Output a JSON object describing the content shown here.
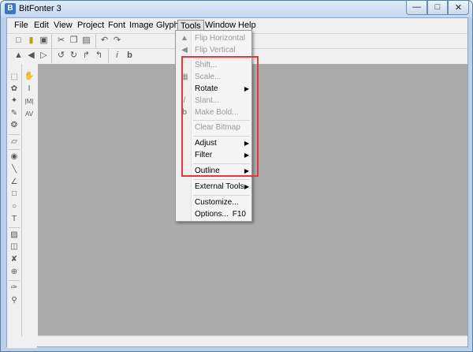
{
  "window": {
    "title": "BitFonter 3",
    "app_icon": "B"
  },
  "menubar": [
    "File",
    "Edit",
    "View",
    "Project",
    "Font",
    "Image",
    "Glyph",
    "Tools",
    "Window",
    "Help"
  ],
  "open_menu": "Tools",
  "tools_menu": {
    "items": [
      {
        "label": "Flip Horizontal",
        "enabled": false,
        "icon": "flip-horizontal-icon"
      },
      {
        "label": "Flip Vertical",
        "enabled": false,
        "icon": "flip-vertical-icon"
      },
      {
        "label": "Shift...",
        "enabled": false
      },
      {
        "label": "Scale...",
        "enabled": false
      },
      {
        "label": "Rotate",
        "enabled": true,
        "submenu": true
      },
      {
        "label": "Slant...",
        "enabled": false
      },
      {
        "label": "Make Bold...",
        "enabled": false
      },
      {
        "label": "Clear Bitmap",
        "enabled": false
      },
      {
        "label": "Adjust",
        "enabled": true,
        "submenu": true
      },
      {
        "label": "Filter",
        "enabled": true,
        "submenu": true
      },
      {
        "label": "Outline",
        "enabled": true,
        "submenu": true
      },
      {
        "label": "External Tools",
        "enabled": true,
        "submenu": true
      },
      {
        "label": "Customize...",
        "enabled": true
      },
      {
        "label": "Options...",
        "enabled": true,
        "shortcut": "F10"
      }
    ]
  },
  "colors": {
    "workspace": "#ababab",
    "highlight": "#e53935",
    "disabled_text": "#9a9a9a"
  }
}
